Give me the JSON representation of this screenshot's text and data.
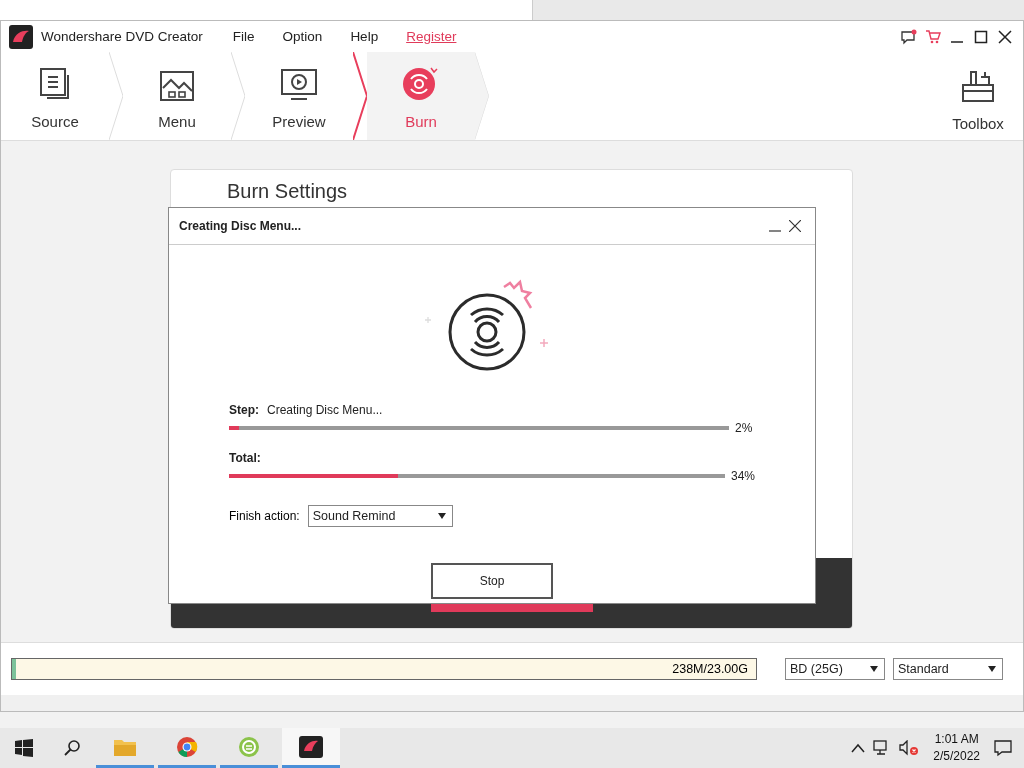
{
  "app": {
    "title": "Wondershare DVD Creator",
    "menu": [
      "File",
      "Option",
      "Help"
    ],
    "register": "Register"
  },
  "steps": [
    {
      "label": "Source",
      "kind": "source",
      "selected": false
    },
    {
      "label": "Menu",
      "kind": "menu",
      "selected": false
    },
    {
      "label": "Preview",
      "kind": "preview",
      "selected": false
    },
    {
      "label": "Burn",
      "kind": "burn",
      "selected": true
    }
  ],
  "toolbox": "Toolbox",
  "card": {
    "title": "Burn Settings"
  },
  "dialog": {
    "title": "Creating Disc Menu...",
    "step": {
      "label": "Step:",
      "text": "Creating Disc Menu...",
      "level": 0.02,
      "reading": "2%"
    },
    "total": {
      "label": "Total:",
      "level": 0.34,
      "reading": "34%"
    },
    "finish_label": "Finish action:",
    "finish_value": "Sound Remind",
    "stop": "Stop"
  },
  "bottom_bar": {
    "capacity": "238M/23.00G",
    "level": 0.006,
    "disc_type": "BD (25G)",
    "quality": "Standard"
  },
  "taskbar": {
    "apps": [
      {
        "kind": "explorer",
        "selected": false
      },
      {
        "kind": "chrome",
        "selected": false
      },
      {
        "kind": "downloader",
        "selected": false
      },
      {
        "kind": "dvd",
        "selected": true
      }
    ],
    "time": "1:01 AM",
    "date": "2/5/2022"
  }
}
